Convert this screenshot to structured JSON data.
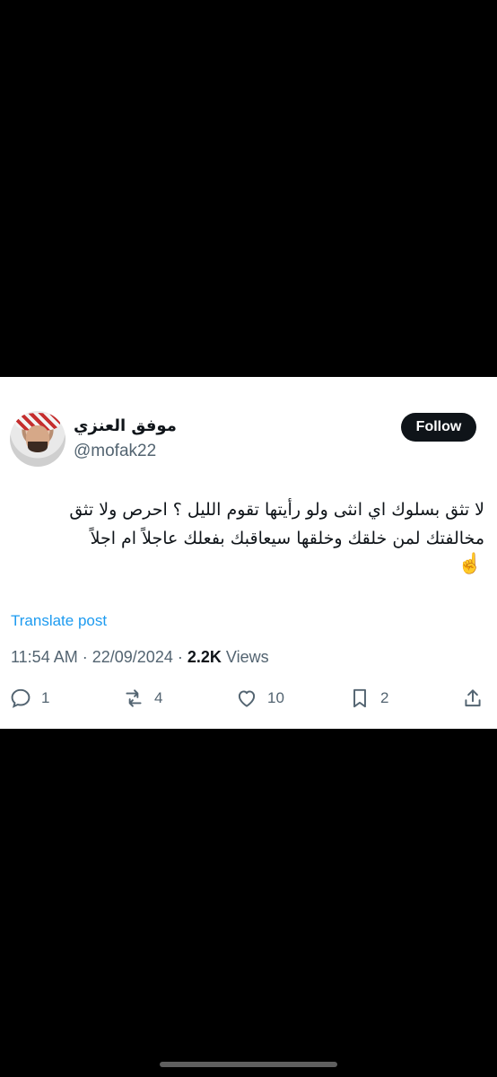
{
  "tweet": {
    "display_name": "موفق العنزي",
    "handle": "@mofak22",
    "follow_label": "Follow",
    "text": "لا تثق بسلوك اي انثى ولو رأيتها تقوم الليل ؟ احرص ولا تثق مخالفتك لمن خلقك وخلقها سيعاقبك بفعلك عاجلاً ام اجلاً",
    "emoji": "☝️",
    "translate_label": "Translate post",
    "time": "11:54 AM",
    "date": "22/09/2024",
    "views_count": "2.2K",
    "views_label": "Views",
    "separator": "·"
  },
  "actions": {
    "replies": "1",
    "reposts": "4",
    "likes": "10",
    "bookmarks": "2"
  },
  "icons": [
    "reply-icon",
    "repost-icon",
    "like-icon",
    "bookmark-icon",
    "share-icon"
  ]
}
